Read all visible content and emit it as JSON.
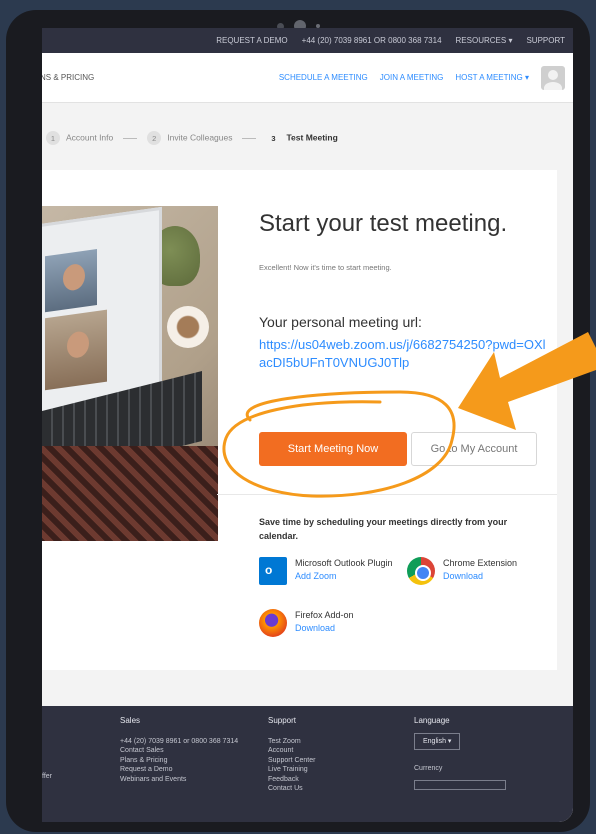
{
  "topbar": {
    "request_demo": "REQUEST A DEMO",
    "phone": "+44 (20) 7039 8961 OR 0800 368 7314",
    "resources": "RESOURCES",
    "support": "SUPPORT"
  },
  "navbar": {
    "plans_pricing": "NS & PRICING",
    "schedule": "SCHEDULE A MEETING",
    "join": "JOIN A MEETING",
    "host": "HOST A MEETING ▾"
  },
  "steps": [
    {
      "num": "1",
      "label": "Account Info"
    },
    {
      "num": "2",
      "label": "Invite Colleagues"
    },
    {
      "num": "3",
      "label": "Test Meeting"
    }
  ],
  "main": {
    "headline": "Start your test meeting.",
    "subtitle": "Excellent! Now it's time to start meeting.",
    "url_label": "Your personal meeting url:",
    "url": "https://us04web.zoom.us/j/6682754250?pwd=OXlacDI5bUFnT0VNUGJ0Tlp",
    "start_button": "Start Meeting Now",
    "account_button": "Go to My Account",
    "save_time": "Save time by scheduling your meetings directly from your calendar."
  },
  "integrations": {
    "outlook_name": "Microsoft Outlook Plugin",
    "outlook_action": "Add Zoom",
    "chrome_name": "Chrome Extension",
    "chrome_action": "Download",
    "firefox_name": "Firefox Add-on",
    "firefox_action": "Download"
  },
  "footer": {
    "sales_title": "Sales",
    "sales_phone": "+44 (20) 7039 8961 or 0800 368 7314",
    "sales_1": "Contact Sales",
    "sales_2": "Plans & Pricing",
    "sales_3": "Request a Demo",
    "sales_4": "Webinars and Events",
    "support_title": "Support",
    "support_1": "Test Zoom",
    "support_2": "Account",
    "support_3": "Support Center",
    "support_4": "Live Training",
    "support_5": "Feedback",
    "support_6": "Contact Us",
    "language_title": "Language",
    "language_value": "English ▾",
    "currency_title": "Currency",
    "left_stub": "ffer"
  },
  "colors": {
    "accent_orange": "#f26d21",
    "link_blue": "#2d8cff",
    "annotation": "#f59a1b"
  }
}
